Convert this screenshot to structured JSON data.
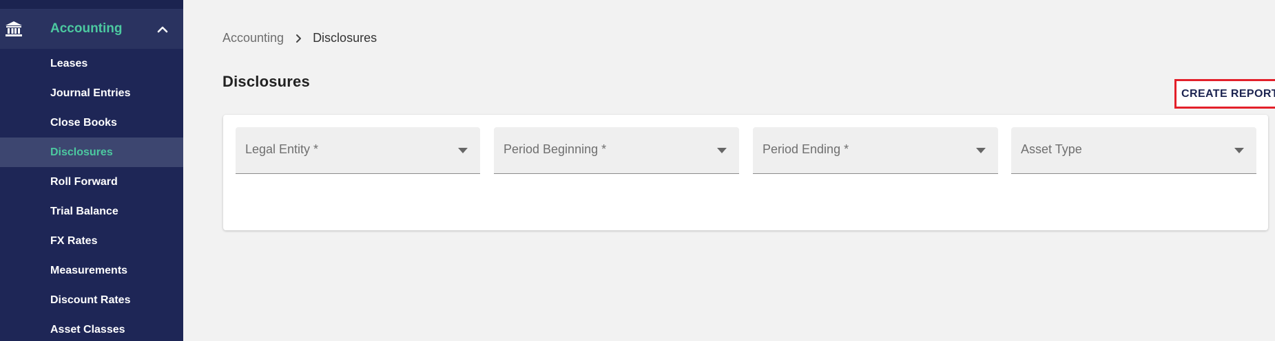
{
  "sidebar": {
    "section": {
      "label": "Accounting",
      "icon": "bank-icon",
      "expand_icon": "chevron-up-icon"
    },
    "items": [
      {
        "label": "Leases",
        "active": false
      },
      {
        "label": "Journal Entries",
        "active": false
      },
      {
        "label": "Close Books",
        "active": false
      },
      {
        "label": "Disclosures",
        "active": true
      },
      {
        "label": "Roll Forward",
        "active": false
      },
      {
        "label": "Trial Balance",
        "active": false
      },
      {
        "label": "FX Rates",
        "active": false
      },
      {
        "label": "Measurements",
        "active": false
      },
      {
        "label": "Discount Rates",
        "active": false
      },
      {
        "label": "Asset Classes",
        "active": false
      }
    ]
  },
  "breadcrumb": {
    "root": "Accounting",
    "separator_icon": "chevron-right-icon",
    "current": "Disclosures"
  },
  "page": {
    "title": "Disclosures"
  },
  "filters": [
    {
      "label": "Legal Entity *"
    },
    {
      "label": "Period Beginning *"
    },
    {
      "label": "Period Ending *"
    },
    {
      "label": "Asset Type"
    }
  ],
  "actions": {
    "create_report": "CREATE REPORT"
  },
  "colors": {
    "sidebar_bg": "#1b2350",
    "accent_green": "#4cc9a0",
    "highlight_red": "#e3202a"
  }
}
